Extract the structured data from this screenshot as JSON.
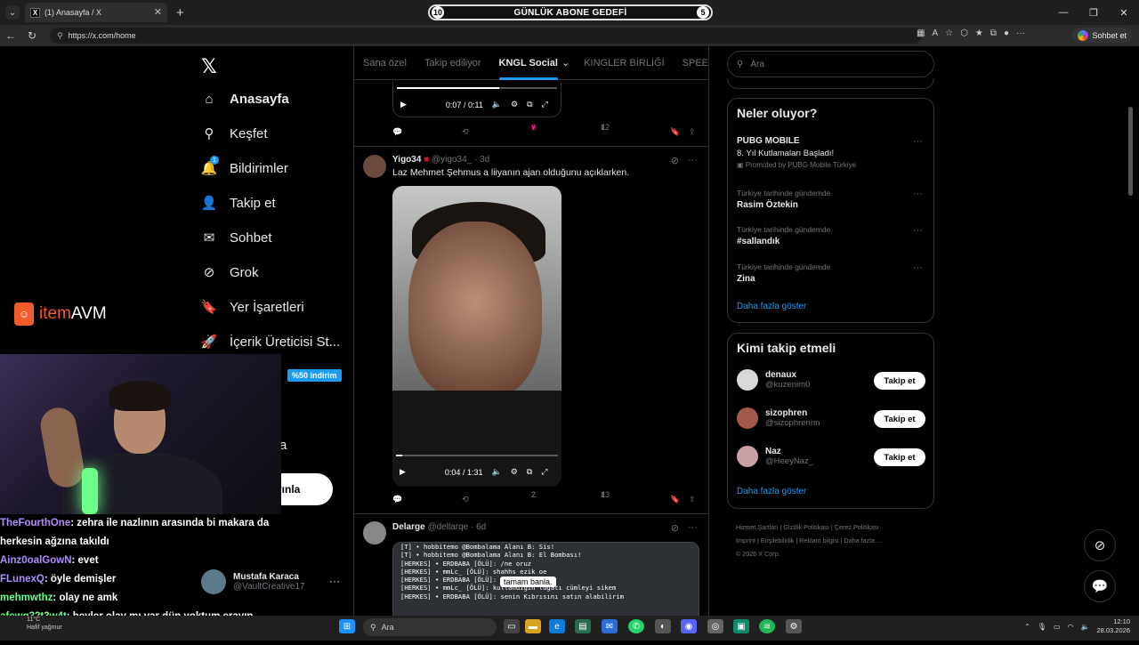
{
  "browser": {
    "tab_title": "(1) Anasayfa / X",
    "url": "https://x.com/home",
    "sohbet_label": "Sohbet et"
  },
  "stream_overlay": {
    "goal_left": "10",
    "goal_label": "GÜNLÜK ABONE GEDEFİ",
    "goal_right": "5",
    "sponsor_brand_a": "item",
    "sponsor_brand_b": "AVM",
    "discount": "%50 indirim",
    "chat": [
      {
        "user": "TheFourthOne",
        "msg": ": zehra ile nazlının arasında bi makara da herkesin ağzına takıldı"
      },
      {
        "user": "Ainz0oalGowN",
        "msg": ": evet"
      },
      {
        "user": "FLunexQ",
        "msg": ": öyle demişler"
      },
      {
        "user": "mehmwthz",
        "msg": ": olay ne amk"
      },
      {
        "user": "afewq32t3w4t",
        "msg": ": beyler olay mı var dün yoktum erayın yayında"
      }
    ]
  },
  "sidebar": {
    "items": [
      {
        "label": "Anasayfa",
        "icon": "home-icon"
      },
      {
        "label": "Keşfet",
        "icon": "search-icon"
      },
      {
        "label": "Bildirimler",
        "icon": "bell-icon",
        "badge": "1"
      },
      {
        "label": "Takip et",
        "icon": "add-user-icon"
      },
      {
        "label": "Sohbet",
        "icon": "mail-icon"
      },
      {
        "label": "Grok",
        "icon": "grok-icon"
      },
      {
        "label": "Yer İşaretleri",
        "icon": "bookmark-icon"
      },
      {
        "label": "İçerik Üreticisi St...",
        "icon": "rocket-icon"
      }
    ],
    "partial_a": "a",
    "post_button": "yınla",
    "account": {
      "name": "Mustafa Karaca",
      "handle": "@VaultCreative17"
    }
  },
  "feed": {
    "tabs": [
      "Sana özel",
      "Takip ediliyor",
      "KNGL Social",
      "KINGLER BİRLİĞİ",
      "SPEED G"
    ],
    "active_tab": "KNGL Social",
    "video1": {
      "time": "0:07 / 0:11",
      "progress": 0.64
    },
    "post1_actions": {
      "likes": "2",
      "views": "12"
    },
    "post2": {
      "name": "Yigo34",
      "handle": "@yigo34_",
      "age": "3d",
      "text": "Laz Mehmet Şehmus a liiyanın ajan olduğunu açıklarken.",
      "video_time": "0:04 / 1:31",
      "progress": 0.04,
      "likes": "2",
      "views": "13"
    },
    "post3": {
      "name": "Delarge",
      "handle": "@dellarqe",
      "age": "6d",
      "popup": "tamam banla.",
      "lines": [
        "[T] • hobbitemo @Bombalama Alanı B: Sis!",
        "[T] • hobbitemo @Bombalama Alanı B: El Bombası!",
        "[HERKES] • ERDBABA [ÖLÜ]: /ne oruz",
        "[HERKES] • mmLc_ [ÖLÜ]:            shahhs ezik oe",
        "[HERKES] • ERDBABA [ÖLÜ]: mmlc",
        "[HERKES] • mmLc_ [ÖLÜ]: kullandıgın lügatı cümleyi sikem",
        "[HERKES] • ERDBABA [ÖLÜ]: senin Kıbrısını satın alabilirim"
      ]
    }
  },
  "right": {
    "search_placeholder": "Ara",
    "trends_title": "Neler oluyor?",
    "trends": [
      {
        "meta": "",
        "title": "PUBG MOBILE",
        "sub": "8. Yıl Kutlamaları Başladı!",
        "promo": "Promoted by PUBG Mobile Türkiye"
      },
      {
        "meta": "Türkiye tarihinde gündemde",
        "title": "Rasim Öztekin"
      },
      {
        "meta": "Türkiye tarihinde gündemde",
        "title": "#sallandık"
      },
      {
        "meta": "Türkiye tarihinde gündemde",
        "title": "Zina"
      }
    ],
    "show_more": "Daha fazla göster",
    "who_title": "Kimi takip etmeli",
    "who": [
      {
        "name": "denaux",
        "handle": "@kuzenim0",
        "color": "#d9d9d9"
      },
      {
        "name": "sizophren",
        "handle": "@sizophrennn",
        "color": "#a35a4a"
      },
      {
        "name": "Naz",
        "handle": "@HeeyNaz_",
        "color": "#c9a0a6"
      }
    ],
    "follow_label": "Takip et",
    "footer": [
      "Hizmet Şartları",
      "Gizlilik Politikası",
      "Çerez Politikası",
      "Imprint",
      "Erişilebilirlik",
      "Reklam bilgisi",
      "Daha fazla ...",
      "© 2026 X Corp."
    ]
  },
  "taskbar": {
    "weather_temp": "11°C",
    "weather_desc": "Hafif yağmur",
    "search": "Ara",
    "time": "12:10",
    "date": "28.03.2026"
  },
  "colors": {
    "accent": "#1d9bf0",
    "like": "#f91880",
    "brand": "#f15a29"
  }
}
